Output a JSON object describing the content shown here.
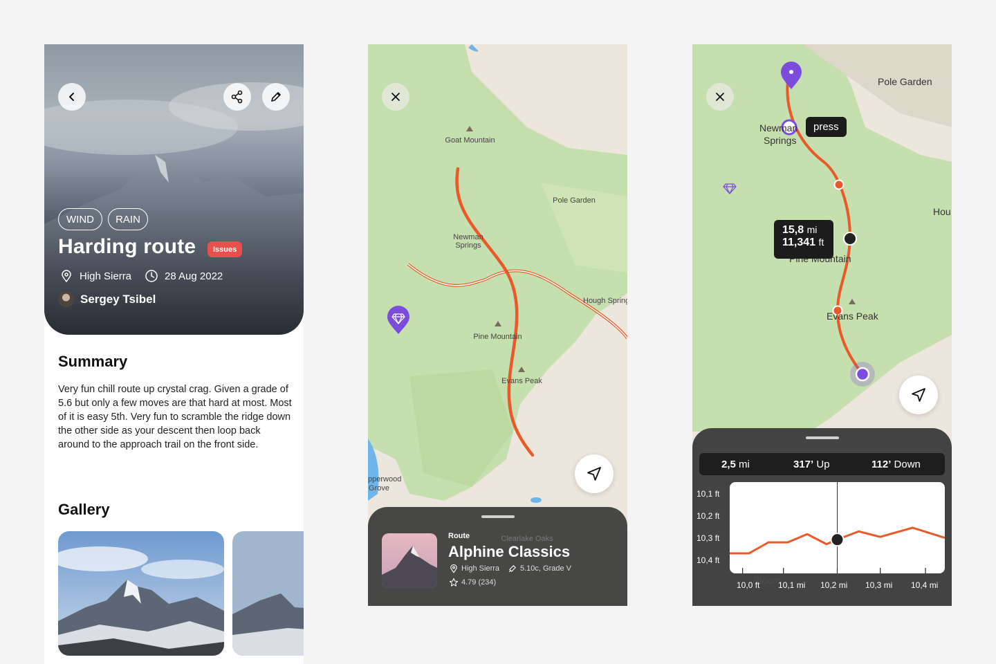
{
  "detail": {
    "tags": [
      "WIND",
      "RAIN"
    ],
    "title": "Harding route",
    "badge": "Issues",
    "location": "High Sierra",
    "date": "28 Aug 2022",
    "author": "Sergey Tsibel",
    "summary_heading": "Summary",
    "summary_text": "Very fun chill route up crystal crag. Given a grade of 5.6 but only a few moves are that hard at most. Most of it is easy 5th. Very fun to scramble the ridge down the other side as your descent then loop back around to the approach trail on the front side.",
    "gallery_heading": "Gallery"
  },
  "map_labels": {
    "goat_mountain": "Goat Mountain",
    "pole_garden": "Pole Garden",
    "newman_springs_1": "Newman",
    "newman_springs_2": "Springs",
    "pine_mountain": "Pine Mountain",
    "evans_peak": "Evans Peak",
    "hough_springs": "Hough Springs",
    "copperwood_1": "pperwood",
    "copperwood_2": "Grove",
    "clearlake": "Clearlake Oaks"
  },
  "route_card": {
    "kicker": "Route",
    "title": "Alphine Classics",
    "location": "High Sierra",
    "grade": "5.10c, Grade V",
    "rating": "4.79 (234)"
  },
  "elevation": {
    "press_label": "press",
    "hover_distance": "15,8",
    "hover_distance_unit": "mi",
    "hover_elevation": "11,341",
    "hover_elevation_unit": "ft",
    "distance": "2,5",
    "distance_unit": "mi",
    "up": "317’",
    "up_label": "Up",
    "down": "112’",
    "down_label": "Down",
    "map_label_hou": "Hou",
    "map_label_bloom": "Bloom"
  },
  "chart_data": {
    "type": "line",
    "y_tick_labels": [
      "10,1 ft",
      "10,2 ft",
      "10,3 ft",
      "10,4 ft"
    ],
    "x_tick_labels": [
      "10,0 ft",
      "10,1 mi",
      "10,2 mi",
      "10,3 mi",
      "10,4 mi"
    ],
    "series": [
      {
        "color": "#e85a2a",
        "points": [
          [
            0,
            0.22
          ],
          [
            0.09,
            0.22
          ],
          [
            0.18,
            0.34
          ],
          [
            0.27,
            0.34
          ],
          [
            0.36,
            0.43
          ],
          [
            0.45,
            0.32
          ],
          [
            0.5,
            0.37
          ],
          [
            0.6,
            0.46
          ],
          [
            0.7,
            0.4
          ],
          [
            0.85,
            0.5
          ],
          [
            1.0,
            0.39
          ]
        ]
      }
    ],
    "cursor_x": 0.5,
    "grid": false
  },
  "colors": {
    "accent": "#e85a2a",
    "marker_purple": "#7c4ddd",
    "badge_red": "#e8514b",
    "sheet_dark": "#3a3a3a"
  },
  "icons": [
    "back-icon",
    "share-icon",
    "edit-icon",
    "pin-icon",
    "clock-icon",
    "close-icon",
    "navigate-icon",
    "diamond-icon",
    "grade-icon",
    "star-icon"
  ]
}
